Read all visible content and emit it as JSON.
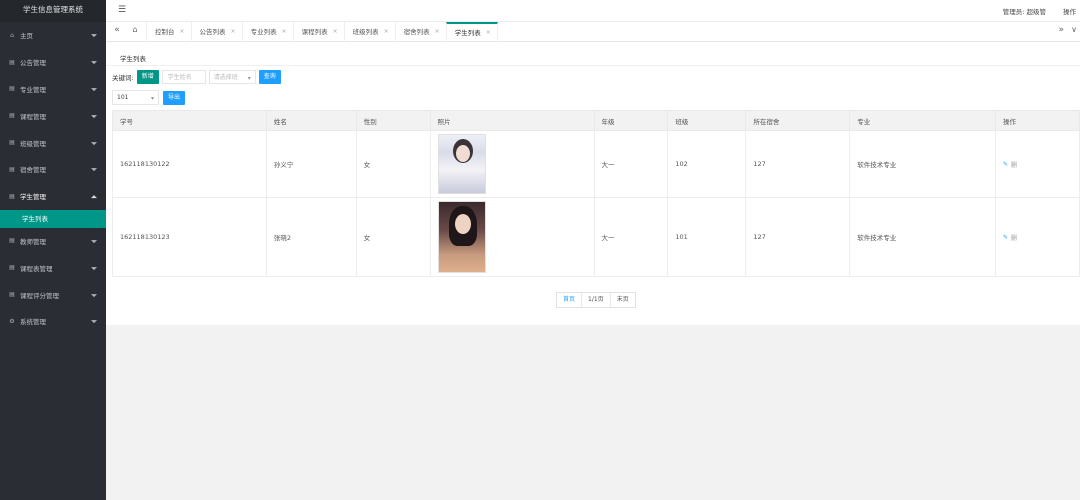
{
  "app": {
    "title": "学生信息管理系统"
  },
  "sidebar": {
    "items": [
      {
        "label": "主页",
        "icon": "home-icon",
        "glyph": "⌂"
      },
      {
        "label": "公告管理",
        "icon": "list-icon",
        "glyph": "▤"
      },
      {
        "label": "专业管理",
        "icon": "list-icon",
        "glyph": "▤"
      },
      {
        "label": "课程管理",
        "icon": "list-icon",
        "glyph": "▤"
      },
      {
        "label": "班级管理",
        "icon": "list-icon",
        "glyph": "▤"
      },
      {
        "label": "宿舍管理",
        "icon": "list-icon",
        "glyph": "▤"
      },
      {
        "label": "学生管理",
        "icon": "list-icon",
        "glyph": "▤",
        "open": true
      },
      {
        "label": "教师管理",
        "icon": "list-icon",
        "glyph": "▤"
      },
      {
        "label": "课程表管理",
        "icon": "list-icon",
        "glyph": "▤"
      },
      {
        "label": "课程评分管理",
        "icon": "list-icon",
        "glyph": "▤"
      },
      {
        "label": "系统管理",
        "icon": "gear-icon",
        "glyph": "⚙"
      }
    ],
    "sub_item": "学生列表"
  },
  "topbar": {
    "admin": "管理员: 超级管",
    "ops": "操作"
  },
  "tabs": {
    "items": [
      "控制台",
      "公告列表",
      "专业列表",
      "课程列表",
      "班级列表",
      "宿舍列表",
      "学生列表"
    ],
    "active_index": 6,
    "close": "×"
  },
  "main": {
    "card_title": "学生列表",
    "keyword_label": "关键词:",
    "add_button": "新增",
    "search_placeholder": "学生姓名",
    "class_select_placeholder": "请选择班",
    "query_button": "查询",
    "room_select_value": "101",
    "export_button": "导出"
  },
  "table": {
    "headers": [
      "学号",
      "姓名",
      "性别",
      "照片",
      "年级",
      "班级",
      "所在宿舍",
      "专业",
      "操作"
    ],
    "rows": [
      {
        "id": "162118130122",
        "name": "孙义宁",
        "gender": "女",
        "grade": "大一",
        "class": "102",
        "room": "127",
        "major": "软件技术专业"
      },
      {
        "id": "162118130123",
        "name": "张晓2",
        "gender": "女",
        "grade": "大一",
        "class": "101",
        "room": "127",
        "major": "软件技术专业"
      }
    ],
    "op_edit_glyph": "✎",
    "op_del": "删"
  },
  "pager": {
    "first": "首页",
    "info": "1/1页",
    "last": "末页"
  },
  "colors": {
    "accent": "#009688",
    "primary": "#1e9fff",
    "sidebar": "#2a2d33"
  }
}
